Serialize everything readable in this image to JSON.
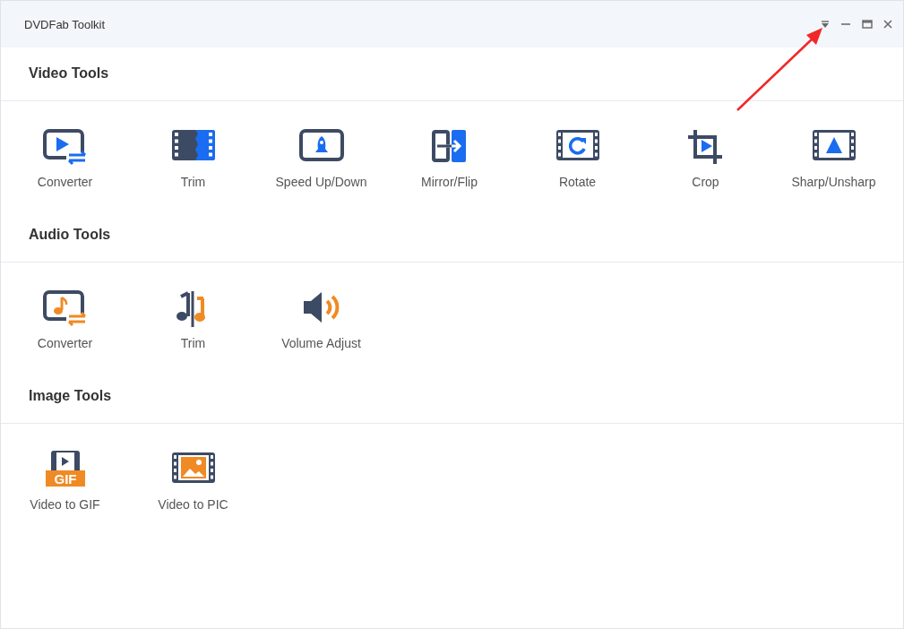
{
  "window": {
    "title": "DVDFab Toolkit"
  },
  "sections": [
    {
      "title": "Video Tools",
      "tools": [
        {
          "label": "Converter",
          "kind": "video-converter"
        },
        {
          "label": "Trim",
          "kind": "video-trim"
        },
        {
          "label": "Speed Up/Down",
          "kind": "speed"
        },
        {
          "label": "Mirror/Flip",
          "kind": "mirror"
        },
        {
          "label": "Rotate",
          "kind": "rotate"
        },
        {
          "label": "Crop",
          "kind": "crop"
        },
        {
          "label": "Sharp/Unsharp",
          "kind": "sharp"
        }
      ]
    },
    {
      "title": "Audio Tools",
      "tools": [
        {
          "label": "Converter",
          "kind": "audio-converter"
        },
        {
          "label": "Trim",
          "kind": "audio-trim"
        },
        {
          "label": "Volume Adjust",
          "kind": "volume"
        }
      ]
    },
    {
      "title": "Image Tools",
      "tools": [
        {
          "label": "Video to GIF",
          "kind": "gif",
          "badge": "GIF"
        },
        {
          "label": "Video to PIC",
          "kind": "pic"
        }
      ]
    }
  ]
}
